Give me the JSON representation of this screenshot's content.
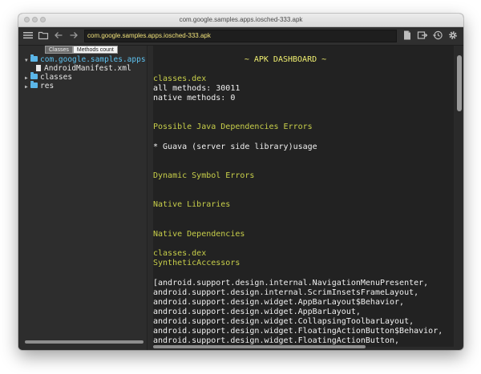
{
  "window": {
    "title": "com.google.samples.apps.iosched-333.apk"
  },
  "toolbar": {
    "path": "com.google.samples.apps.iosched-333.apk"
  },
  "sidebar": {
    "tabs": [
      {
        "label": "Classes",
        "active": true
      },
      {
        "label": "Methods count",
        "active": false
      }
    ],
    "tree": [
      {
        "label": "com.google.samples.apps",
        "type": "folder",
        "expanded": true
      },
      {
        "label": "AndroidManifest.xml",
        "type": "file"
      },
      {
        "label": "classes",
        "type": "folder",
        "expanded": false
      },
      {
        "label": "res",
        "type": "folder",
        "expanded": false
      }
    ]
  },
  "content": {
    "header": "~ APK DASHBOARD ~",
    "dex_name": "classes.dex",
    "all_methods": "all methods: 30011",
    "native_methods": "native methods: 0",
    "dep_errors_title": "Possible Java Dependencies Errors",
    "dep_errors_item": "* Guava (server side library)usage",
    "dynamic_symbol_title": "Dynamic Symbol Errors",
    "native_libs_title": "Native Libraries",
    "native_deps_title": "Native Dependencies",
    "native_deps_dex": "classes.dex",
    "synthetic_title": "SyntheticAccessors",
    "synthetic_lines": [
      "[android.support.design.internal.NavigationMenuPresenter,",
      "android.support.design.internal.ScrimInsetsFrameLayout,",
      "android.support.design.widget.AppBarLayout$Behavior,",
      "android.support.design.widget.AppBarLayout,",
      "android.support.design.widget.CollapsingToolbarLayout,",
      "android.support.design.widget.FloatingActionButton$Behavior,",
      "android.support.design.widget.FloatingActionButton,"
    ]
  },
  "colors": {
    "accent_yellow": "#f0ef70",
    "section_olive": "#c8cf4a",
    "tree_blue": "#5ec2f0"
  }
}
